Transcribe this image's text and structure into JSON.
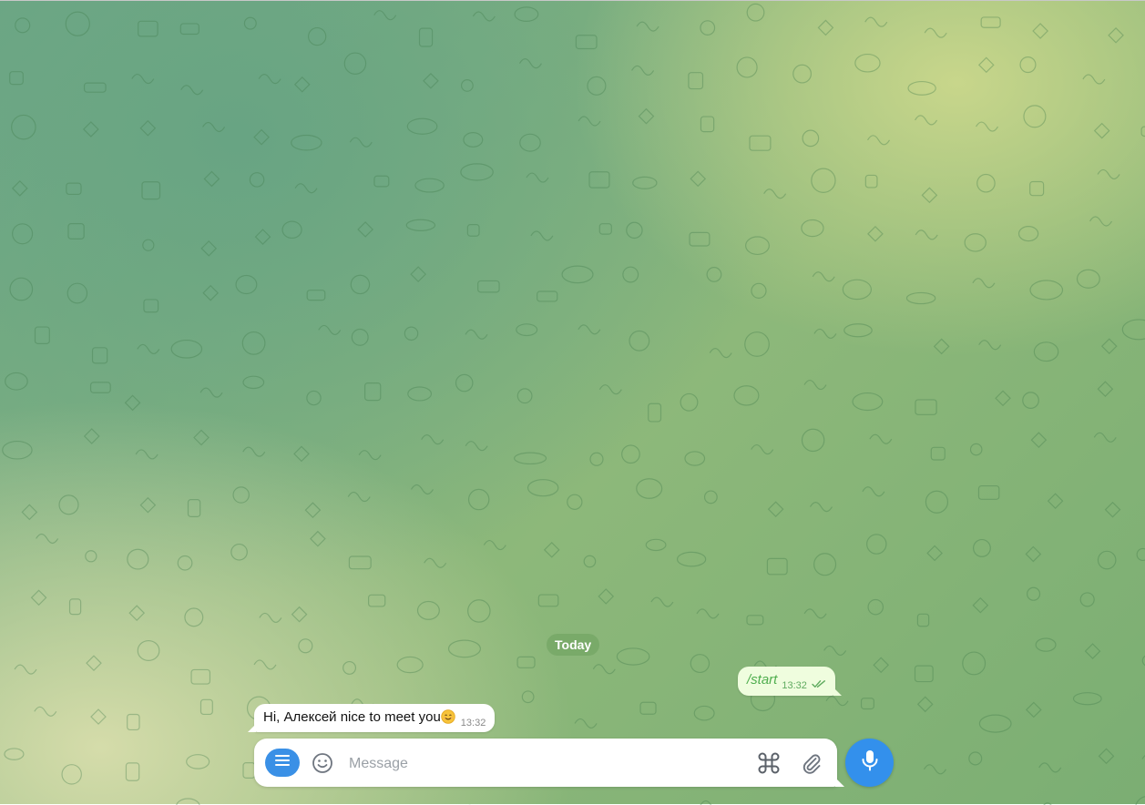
{
  "chat": {
    "date_separator": "Today",
    "messages": [
      {
        "direction": "outgoing",
        "text": "/start",
        "time": "13:32",
        "status": "read"
      },
      {
        "direction": "incoming",
        "text": "Hi, Алексей nice to meet you",
        "emoji": "smiling-face",
        "time": "13:32"
      }
    ]
  },
  "composer": {
    "placeholder": "Message",
    "value": ""
  },
  "icons": {
    "menu": "menu-icon",
    "emoji": "smile-icon",
    "commands": "command-icon",
    "attach": "paperclip-icon",
    "voice": "microphone-icon",
    "read_status": "double-check-icon"
  },
  "colors": {
    "accent": "#3390ec",
    "outgoing_bubble": "#effdde",
    "outgoing_text": "#4fae4e",
    "incoming_bubble": "#ffffff",
    "date_pill": "#6ca05c"
  }
}
